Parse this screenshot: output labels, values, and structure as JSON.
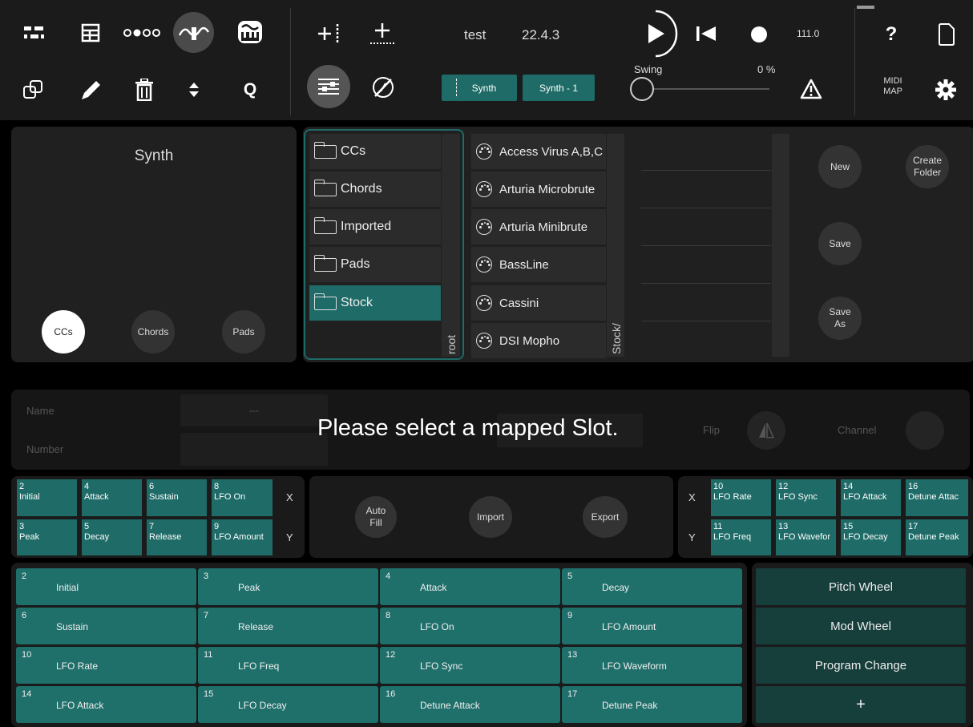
{
  "toolbar": {
    "project_name": "test",
    "version": "22.4.3",
    "tempo": "111.0",
    "help": "?",
    "quantize": "Q",
    "swing_label": "Swing",
    "swing_value": "0 %",
    "swing_level": 0,
    "midi_map_line1": "MIDI",
    "midi_map_line2": "MAP",
    "track_chip": "Synth",
    "pattern_chip": "Synth - 1"
  },
  "instrument": {
    "title": "Synth",
    "tabs": [
      "CCs",
      "Chords",
      "Pads"
    ],
    "selected_tab": "CCs"
  },
  "browser": {
    "folders": [
      "CCs",
      "Chords",
      "Imported",
      "Pads",
      "Stock"
    ],
    "selected_folder": "Stock",
    "root_label": "root",
    "path_label": "Stock/",
    "instruments": [
      "Access Virus A,B,C",
      "Arturia Microbrute",
      "Arturia Minibrute",
      "BassLine",
      "Cassini",
      "DSI Mopho"
    ]
  },
  "actions": {
    "new": "New",
    "create_folder_1": "Create",
    "create_folder_2": "Folder",
    "save": "Save",
    "save_as_1": "Save",
    "save_as_2": "As"
  },
  "slot_editor": {
    "name_label": "Name",
    "name_value": "---",
    "number_label": "Number",
    "message": "Please select a mapped Slot.",
    "flip_label": "Flip",
    "channel_label": "Channel"
  },
  "xy": {
    "x_label": "X",
    "y_label": "Y",
    "left_x": [
      {
        "n": "2",
        "l": "Initial"
      },
      {
        "n": "4",
        "l": "Attack"
      },
      {
        "n": "6",
        "l": "Sustain"
      },
      {
        "n": "8",
        "l": "LFO On"
      }
    ],
    "left_y": [
      {
        "n": "3",
        "l": "Peak"
      },
      {
        "n": "5",
        "l": "Decay"
      },
      {
        "n": "7",
        "l": "Release"
      },
      {
        "n": "9",
        "l": "LFO Amount"
      }
    ],
    "right_x": [
      {
        "n": "10",
        "l": "LFO Rate"
      },
      {
        "n": "12",
        "l": "LFO Sync"
      },
      {
        "n": "14",
        "l": "LFO Attack"
      },
      {
        "n": "16",
        "l": "Detune Attac"
      }
    ],
    "right_y": [
      {
        "n": "11",
        "l": "LFO Freq"
      },
      {
        "n": "13",
        "l": "LFO Wavefor"
      },
      {
        "n": "15",
        "l": "LFO Decay"
      },
      {
        "n": "17",
        "l": "Detune Peak"
      }
    ],
    "auto_fill_1": "Auto",
    "auto_fill_2": "Fill",
    "import": "Import",
    "export": "Export"
  },
  "pads": [
    {
      "n": "2",
      "l": "Initial"
    },
    {
      "n": "3",
      "l": "Peak"
    },
    {
      "n": "4",
      "l": "Attack"
    },
    {
      "n": "5",
      "l": "Decay"
    },
    {
      "n": "6",
      "l": "Sustain"
    },
    {
      "n": "7",
      "l": "Release"
    },
    {
      "n": "8",
      "l": "LFO On"
    },
    {
      "n": "9",
      "l": "LFO Amount"
    },
    {
      "n": "10",
      "l": "LFO Rate"
    },
    {
      "n": "11",
      "l": "LFO Freq"
    },
    {
      "n": "12",
      "l": "LFO Sync"
    },
    {
      "n": "13",
      "l": "LFO Waveform"
    },
    {
      "n": "14",
      "l": "LFO Attack"
    },
    {
      "n": "15",
      "l": "LFO Decay"
    },
    {
      "n": "16",
      "l": "Detune Attack"
    },
    {
      "n": "17",
      "l": "Detune Peak"
    }
  ],
  "special": [
    "Pitch Wheel",
    "Mod Wheel",
    "Program Change",
    "+"
  ],
  "colors": {
    "accent": "#1e6b67",
    "dark_accent": "#163e3b",
    "background": "#000000"
  }
}
